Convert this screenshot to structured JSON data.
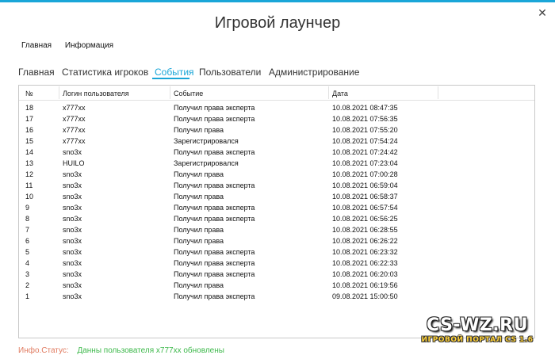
{
  "window": {
    "title": "Игровой лаунчер",
    "close_glyph": "✕",
    "accent": "#1aa6d8"
  },
  "menu": [
    "Главная",
    "Информация"
  ],
  "tabs": [
    "Главная",
    "Статистика игроков",
    "События",
    "Пользователи",
    "Администрирование"
  ],
  "active_tab": "События",
  "table": {
    "headers": [
      "№",
      "Логин пользователя",
      "Событие",
      "Дата"
    ],
    "rows": [
      [
        "18",
        "x777xx",
        "Получил права эксперта",
        "10.08.2021 08:47:35"
      ],
      [
        "17",
        "x777xx",
        "Получил права эксперта",
        "10.08.2021 07:56:35"
      ],
      [
        "16",
        "x777xx",
        "Получил права",
        "10.08.2021 07:55:20"
      ],
      [
        "15",
        "x777xx",
        "Зарегистрировался",
        "10.08.2021 07:54:24"
      ],
      [
        "14",
        "sno3x",
        "Получил права эксперта",
        "10.08.2021 07:24:42"
      ],
      [
        "13",
        "HUILO",
        "Зарегистрировался",
        "10.08.2021 07:23:04"
      ],
      [
        "12",
        "sno3x",
        "Получил права",
        "10.08.2021 07:00:28"
      ],
      [
        "11",
        "sno3x",
        "Получил права эксперта",
        "10.08.2021 06:59:04"
      ],
      [
        "10",
        "sno3x",
        "Получил права",
        "10.08.2021 06:58:37"
      ],
      [
        "9",
        "sno3x",
        "Получил права эксперта",
        "10.08.2021 06:57:54"
      ],
      [
        "8",
        "sno3x",
        "Получил права эксперта",
        "10.08.2021 06:56:25"
      ],
      [
        "7",
        "sno3x",
        "Получил права",
        "10.08.2021 06:28:55"
      ],
      [
        "6",
        "sno3x",
        "Получил права",
        "10.08.2021 06:26:22"
      ],
      [
        "5",
        "sno3x",
        "Получил права эксперта",
        "10.08.2021 06:23:32"
      ],
      [
        "4",
        "sno3x",
        "Получил права эксперта",
        "10.08.2021 06:22:33"
      ],
      [
        "3",
        "sno3x",
        "Получил права эксперта",
        "10.08.2021 06:20:03"
      ],
      [
        "2",
        "sno3x",
        "Получил права",
        "10.08.2021 06:19:56"
      ],
      [
        "1",
        "sno3x",
        "Получил права эксперта",
        "09.08.2021 15:00:50"
      ]
    ]
  },
  "status": {
    "label": "Инфо.Статус:",
    "message": "Данны пользователя x777xx обновлены",
    "label_color": "#e07a5f",
    "message_color": "#3cb84a"
  },
  "watermark": {
    "title": "CS-WZ.RU",
    "subtitle": "ИГРОВОЙ ПОРТАЛ CS 1.6"
  }
}
